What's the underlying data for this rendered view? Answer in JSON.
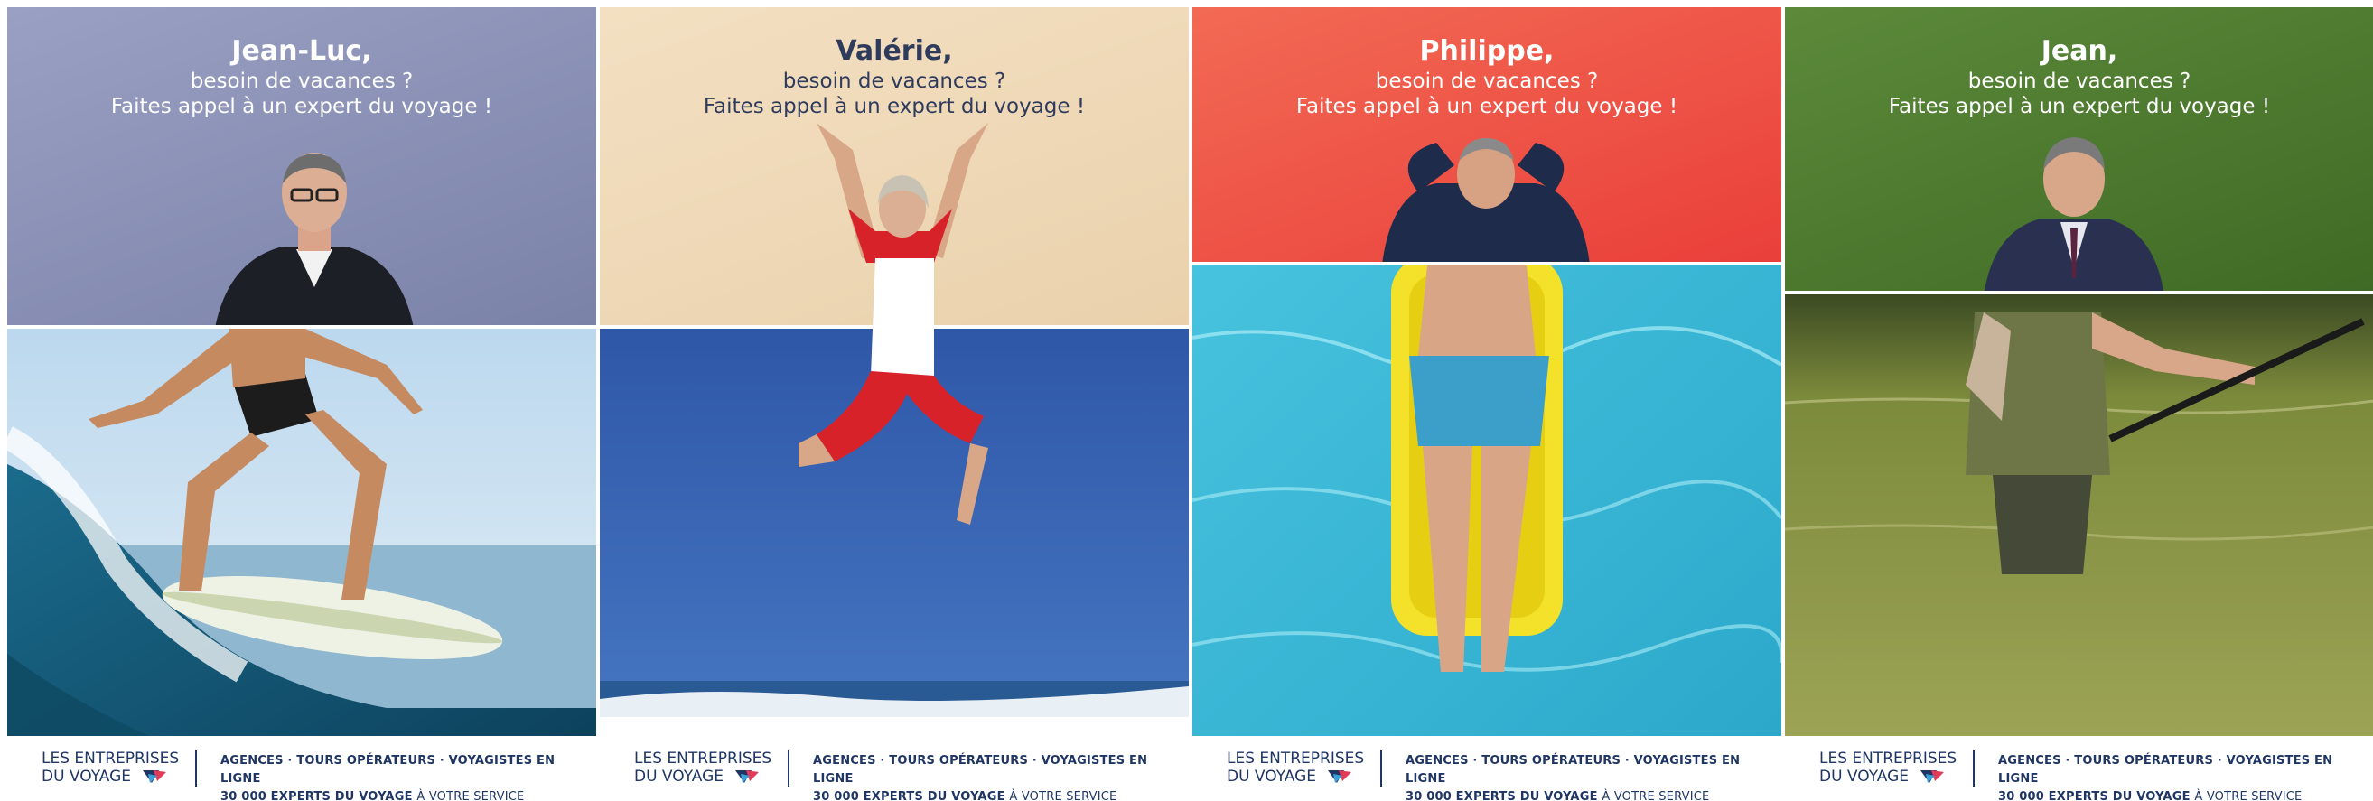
{
  "panels": [
    {
      "name": "Jean-Luc,",
      "line1": "besoin de vacances ?",
      "line2": "Faites appel à un expert du voyage !",
      "top_color": "#8a90b3",
      "scene": "surfer"
    },
    {
      "name": "Valérie,",
      "line1": "besoin de vacances ?",
      "line2": "Faites appel à un expert du voyage !",
      "top_color": "#efd9b8",
      "scene": "jumping-beach"
    },
    {
      "name": "Philippe,",
      "line1": "besoin de vacances ?",
      "line2": "Faites appel à un expert du voyage !",
      "top_color": "#f0594a",
      "scene": "pool-float"
    },
    {
      "name": "Jean,",
      "line1": "besoin de vacances ?",
      "line2": "Faites appel à un expert du voyage !",
      "top_color": "#4e7a2e",
      "scene": "fly-fishing"
    }
  ],
  "footer": {
    "brand_line1": "LES ENTREPRISES",
    "brand_line2": "DU VOYAGE",
    "tag_line1": "AGENCES · TOURS OPÉRATEURS · VOYAGISTES EN LIGNE",
    "tag_line2_bold": "30 000 EXPERTS DU VOYAGE",
    "tag_line2_light": "À VOTRE SERVICE",
    "brand_color": "#1f3563",
    "logo_colors": [
      "#1f3563",
      "#e23b5a",
      "#3aa0d8"
    ]
  }
}
